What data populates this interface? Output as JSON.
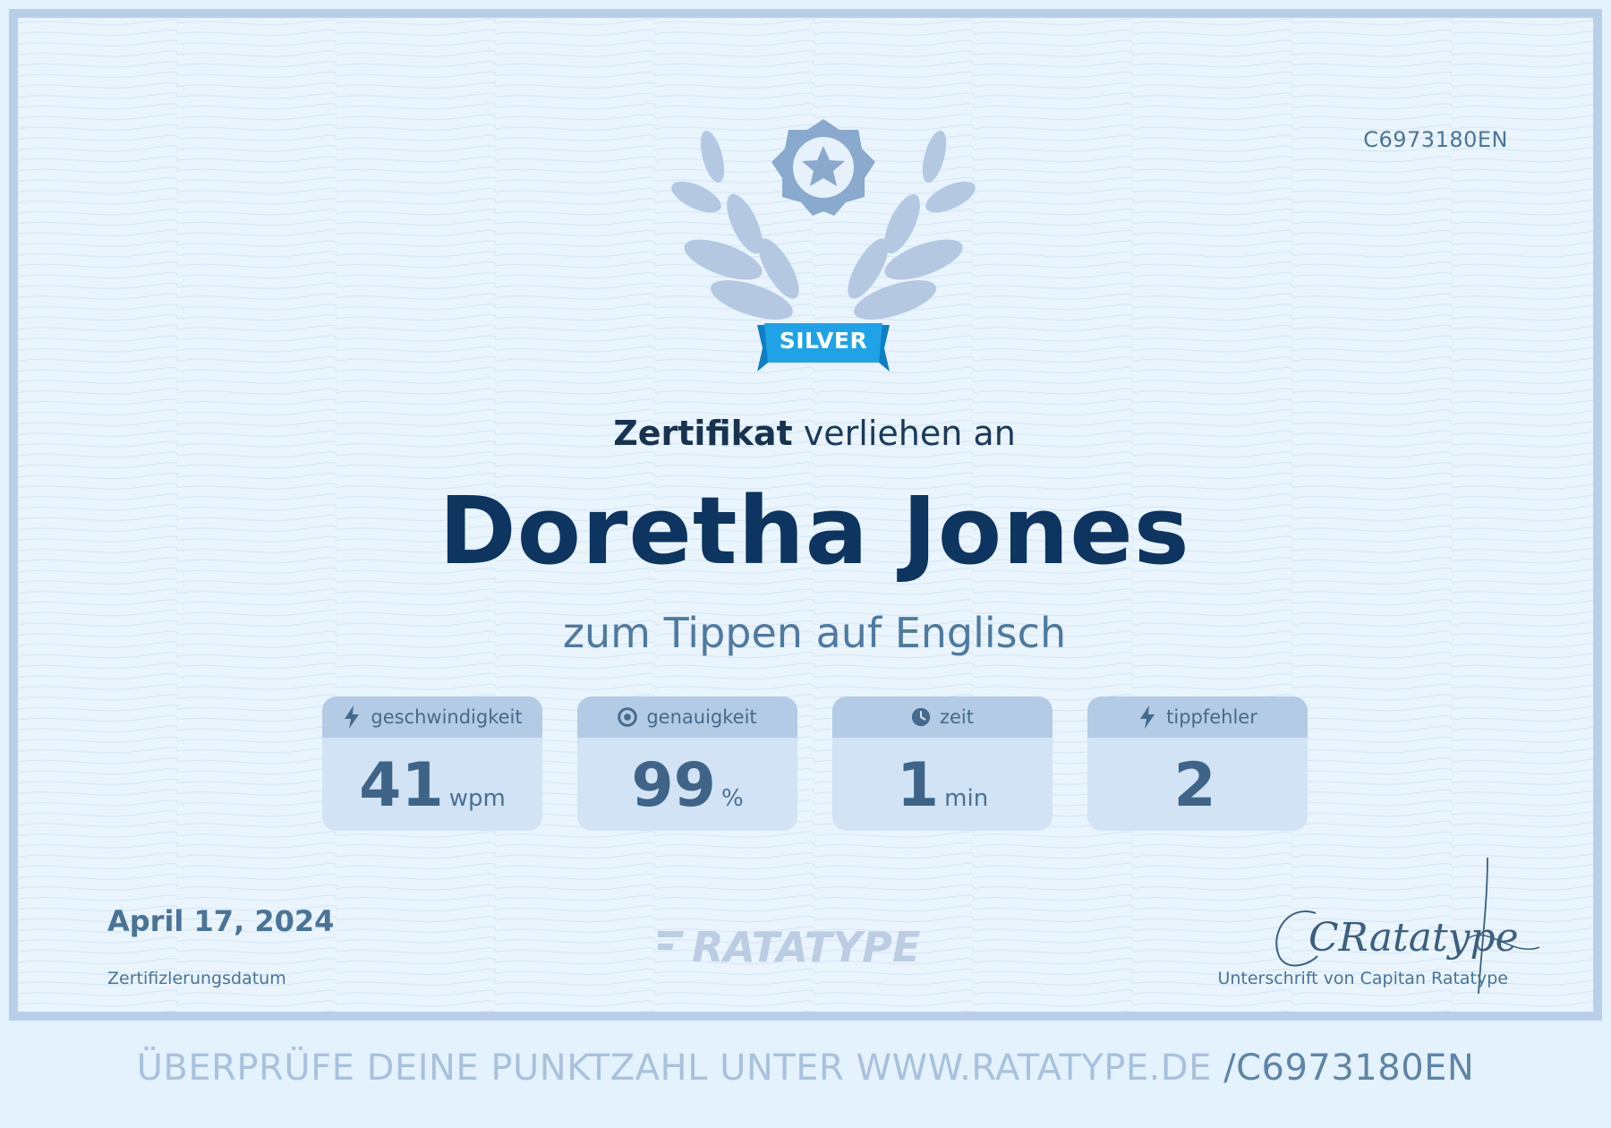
{
  "certificate": {
    "id": "C6973180EN",
    "badge": "SILVER",
    "heading_strong": "Zertifikat",
    "heading_rest": " verliehen an",
    "recipient": "Doretha Jones",
    "subtitle": "zum Tippen auf Englisch",
    "stats": [
      {
        "icon": "lightning-icon",
        "label": "geschwindigkeit",
        "value": "41",
        "unit": "wpm"
      },
      {
        "icon": "target-icon",
        "label": "genauigkeit",
        "value": "99",
        "unit": "%"
      },
      {
        "icon": "clock-icon",
        "label": "zeit",
        "value": "1",
        "unit": "min"
      },
      {
        "icon": "lightning-icon",
        "label": "tippfehler",
        "value": "2",
        "unit": ""
      }
    ],
    "date": "April 17, 2024",
    "date_label": "Zertifizlerungsdatum",
    "logo": "RATATYPE",
    "signature_text": "CRatatype",
    "signature_label": "Unterschrift von Capitan Ratatype"
  },
  "footer": {
    "verify_text": "ÜBERPRÜFE DEINE PUNKTZAHL UNTER WWW.RATATYPE.DE",
    "verify_code": "/C6973180EN"
  },
  "colors": {
    "background": "#e4f2fd",
    "border": "#b9cfe9",
    "badge_blue": "#1ea3e8",
    "emblem_dark": "#89a9cd",
    "emblem_light": "#b4c8e2",
    "name": "#0e3460",
    "accent_text": "#4f7aa0"
  }
}
